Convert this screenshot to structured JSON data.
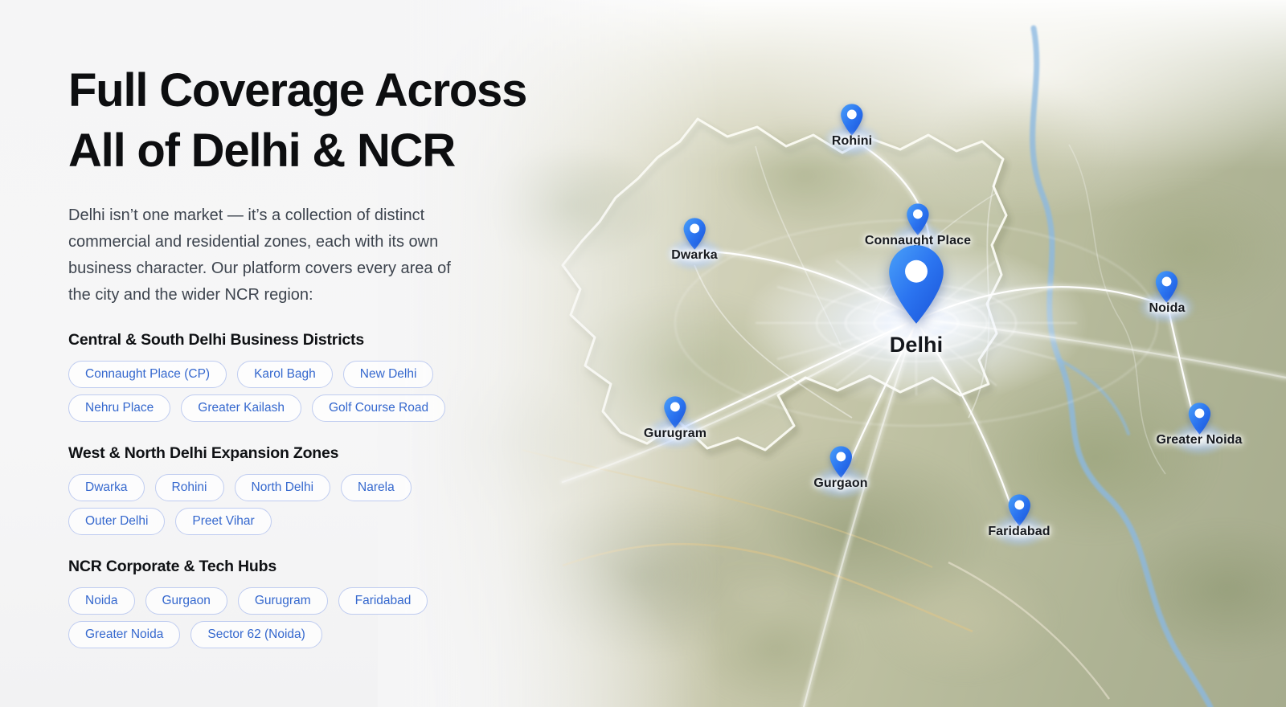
{
  "hero": {
    "title_line1": "Full Coverage Across",
    "title_line2": "All of Delhi & NCR",
    "description": "Delhi isn’t one market — it’s a collection of distinct commercial and residential zones, each with its own business character. Our platform covers every area of the city and the wider NCR region:"
  },
  "sections": [
    {
      "heading": "Central & South Delhi Business Districts",
      "chips": [
        "Connaught Place (CP)",
        "Karol Bagh",
        "New Delhi",
        "Nehru Place",
        "Greater Kailash",
        "Golf Course Road"
      ]
    },
    {
      "heading": "West & North Delhi Expansion Zones",
      "chips": [
        "Dwarka",
        "Rohini",
        "North Delhi",
        "Narela",
        "Outer Delhi",
        "Preet Vihar"
      ]
    },
    {
      "heading": "NCR Corporate & Tech Hubs",
      "chips": [
        "Noida",
        "Gurgaon",
        "Gurugram",
        "Faridabad",
        "Greater Noida",
        "Sector 62 (Noida)"
      ]
    }
  ],
  "map": {
    "center": {
      "label": "Delhi"
    },
    "markers": [
      {
        "id": "rohini",
        "label": "Rohini"
      },
      {
        "id": "connaught-place",
        "label": "Connaught Place"
      },
      {
        "id": "dwarka",
        "label": "Dwarka"
      },
      {
        "id": "noida",
        "label": "Noida"
      },
      {
        "id": "gurugram",
        "label": "Gurugram"
      },
      {
        "id": "gurgaon",
        "label": "Gurgaon"
      },
      {
        "id": "faridabad",
        "label": "Faridabad"
      },
      {
        "id": "greater-noida",
        "label": "Greater Noida"
      }
    ]
  },
  "colors": {
    "chip_text": "#3568ce",
    "chip_border": "#bfccf0",
    "pin_blue_light": "#3f8bf7",
    "pin_blue_dark": "#1a53d8",
    "heading_text": "#0d0e10",
    "body_text": "#3d444e",
    "river_blue": "#8ab9e2"
  }
}
